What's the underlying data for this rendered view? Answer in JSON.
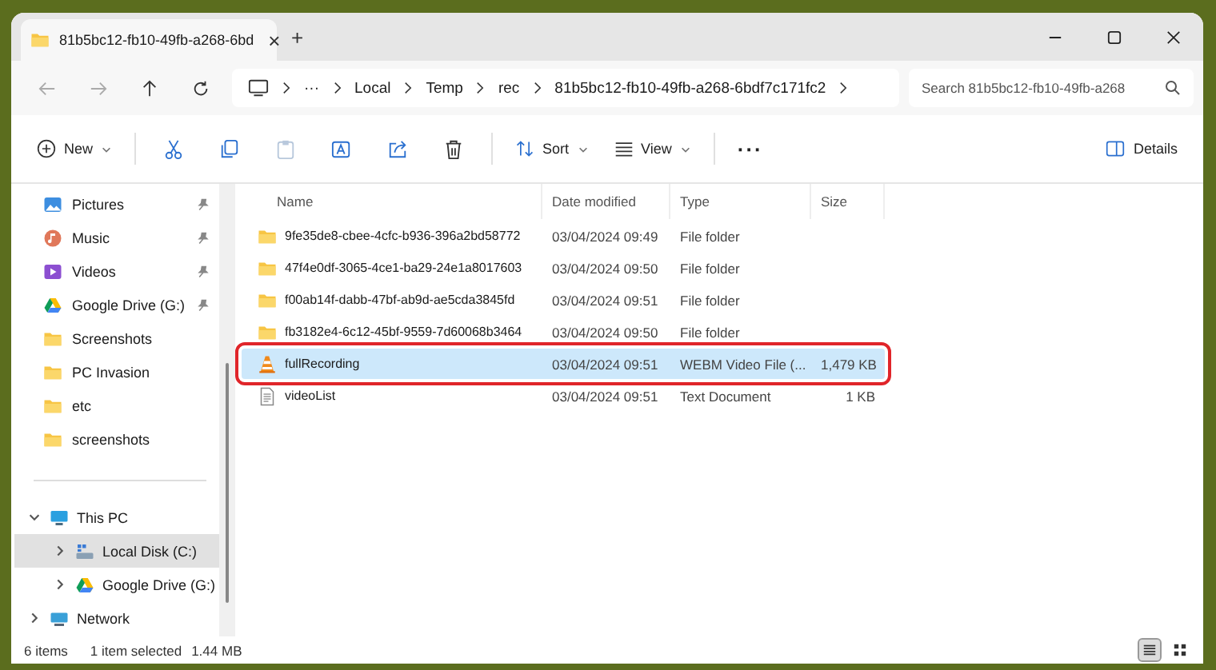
{
  "tab": {
    "title": "81b5bc12-fb10-49fb-a268-6bd",
    "close": "×",
    "new": "+"
  },
  "address": {
    "overflow": "···",
    "crumbs": [
      "Local",
      "Temp",
      "rec",
      "81b5bc12-fb10-49fb-a268-6bdf7c171fc2"
    ],
    "search_placeholder": "Search 81b5bc12-fb10-49fb-a268"
  },
  "toolbar": {
    "new": "New",
    "sort": "Sort",
    "view": "View",
    "more": "···",
    "details": "Details"
  },
  "quick_access": [
    {
      "label": "Pictures",
      "kind": "pictures",
      "pinned": true
    },
    {
      "label": "Music",
      "kind": "music",
      "pinned": true
    },
    {
      "label": "Videos",
      "kind": "videos",
      "pinned": true
    },
    {
      "label": "Google Drive (G:)",
      "kind": "drive",
      "pinned": true
    },
    {
      "label": "Screenshots",
      "kind": "folder",
      "pinned": false
    },
    {
      "label": "PC Invasion",
      "kind": "folder",
      "pinned": false
    },
    {
      "label": "etc",
      "kind": "folder",
      "pinned": false
    },
    {
      "label": "screenshots",
      "kind": "folder",
      "pinned": false
    }
  ],
  "tree": [
    {
      "label": "This PC",
      "kind": "pc",
      "expanded": true,
      "selected": false,
      "children": [
        {
          "label": "Local Disk (C:)",
          "kind": "disk",
          "expanded": false,
          "selected": true
        },
        {
          "label": "Google Drive (G:)",
          "kind": "drive",
          "expanded": false,
          "selected": false
        }
      ]
    },
    {
      "label": "Network",
      "kind": "network",
      "expanded": false,
      "selected": false
    }
  ],
  "columns": [
    "Name",
    "Date modified",
    "Type",
    "Size"
  ],
  "files": [
    {
      "name": "9fe35de8-cbee-4cfc-b936-396a2bd58772",
      "date": "03/04/2024 09:49",
      "type": "File folder",
      "kind": "folder",
      "selected": false,
      "highlighted": false
    },
    {
      "name": "47f4e0df-3065-4ce1-ba29-24e1a8017603",
      "date": "03/04/2024 09:50",
      "type": "File folder",
      "kind": "folder",
      "selected": false,
      "highlighted": false
    },
    {
      "name": "f00ab14f-dabb-47bf-ab9d-ae5cda3845fd",
      "date": "03/04/2024 09:51",
      "type": "File folder",
      "kind": "folder",
      "selected": false,
      "highlighted": false
    },
    {
      "name": "fb3182e4-6c12-45bf-9559-7d60068b3464",
      "date": "03/04/2024 09:50",
      "type": "File folder",
      "kind": "folder",
      "selected": false,
      "highlighted": false
    },
    {
      "name": "fullRecording",
      "date": "03/04/2024 09:51",
      "type": "WEBM Video File (...",
      "size": "1,479 KB",
      "kind": "video",
      "selected": true,
      "highlighted": true
    },
    {
      "name": "videoList",
      "date": "03/04/2024 09:51",
      "type": "Text Document",
      "size": "1 KB",
      "kind": "text",
      "selected": false,
      "highlighted": false
    }
  ],
  "status_bar": {
    "count": "6 items",
    "selection": "1 item selected",
    "size": "1.44 MB"
  },
  "view_buttons": [
    {
      "kind": "details",
      "selected": true
    },
    {
      "kind": "tiles",
      "selected": false
    }
  ]
}
